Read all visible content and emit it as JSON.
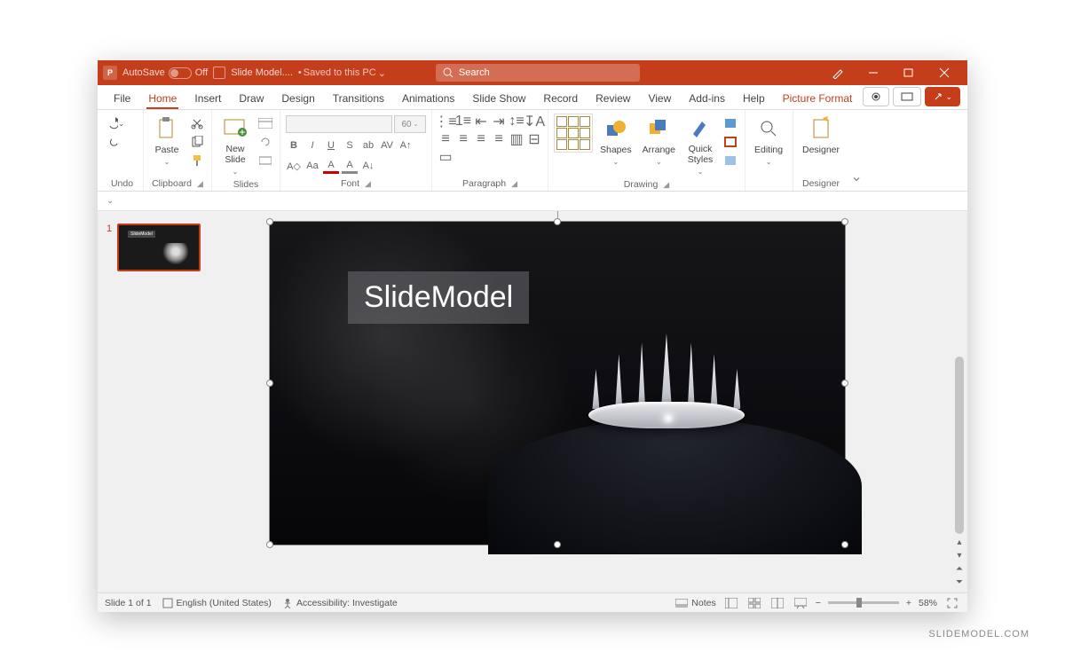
{
  "titlebar": {
    "autosave_label": "AutoSave",
    "autosave_state": "Off",
    "file_name": "Slide Model....",
    "save_status": "Saved to this PC",
    "search_placeholder": "Search"
  },
  "menu": {
    "file": "File",
    "home": "Home",
    "insert": "Insert",
    "draw": "Draw",
    "design": "Design",
    "transitions": "Transitions",
    "animations": "Animations",
    "slideshow": "Slide Show",
    "record": "Record",
    "review": "Review",
    "view": "View",
    "addins": "Add-ins",
    "help": "Help",
    "picture_format": "Picture Format"
  },
  "ribbon": {
    "undo_group": "Undo",
    "clipboard_group": "Clipboard",
    "paste": "Paste",
    "slides_group": "Slides",
    "new_slide": "New\nSlide",
    "font_group": "Font",
    "font_size_placeholder": "60",
    "paragraph_group": "Paragraph",
    "drawing_group": "Drawing",
    "shapes": "Shapes",
    "arrange": "Arrange",
    "quick_styles": "Quick\nStyles",
    "editing": "Editing",
    "designer_group": "Designer",
    "designer": "Designer"
  },
  "thumbnails": {
    "slide1_num": "1"
  },
  "slide": {
    "textbox_text": "SlideModel"
  },
  "status": {
    "slide_counter": "Slide 1 of 1",
    "language": "English (United States)",
    "accessibility": "Accessibility: Investigate",
    "notes": "Notes",
    "zoom_pct": "58%"
  },
  "watermark": "SLIDEMODEL.COM"
}
